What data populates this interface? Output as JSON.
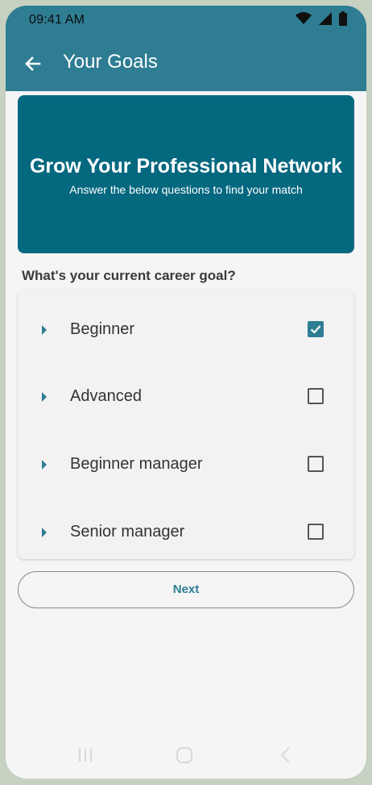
{
  "status_bar": {
    "time": "09:41 AM",
    "icons": [
      "wifi-icon",
      "cellular-signal-icon",
      "battery-icon"
    ]
  },
  "app_bar": {
    "title": "Your Goals",
    "back_icon": "arrow-back-icon"
  },
  "hero": {
    "title": "Grow Your Professional Network",
    "subtitle": "Answer the below questions to find your match"
  },
  "question": "What's your current career goal?",
  "options": [
    {
      "label": "Beginner",
      "checked": true
    },
    {
      "label": "Advanced",
      "checked": false
    },
    {
      "label": "Beginner manager",
      "checked": false
    },
    {
      "label": "Senior manager",
      "checked": false
    }
  ],
  "next_button": "Next",
  "nav_bar": [
    "recent-apps-icon",
    "home-icon",
    "back-icon"
  ],
  "colors": {
    "primary": "#2e7d93",
    "hero_background": "#04687f",
    "frame": "#c6d1c2"
  }
}
